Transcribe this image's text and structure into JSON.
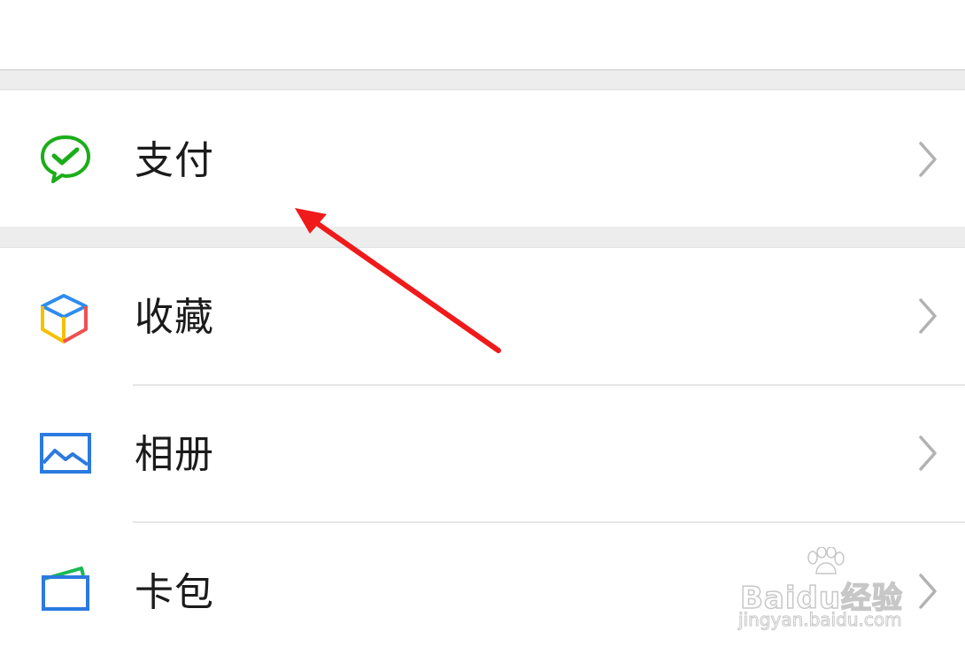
{
  "menu": {
    "items": [
      {
        "label": "支付",
        "icon": "wechat-pay-icon",
        "icon_color": "#1aad19"
      },
      {
        "label": "收藏",
        "icon": "favorites-cube-icon",
        "icon_colors": [
          "#2d8cf0",
          "#f5c000",
          "#f05050"
        ]
      },
      {
        "label": "相册",
        "icon": "album-picture-icon",
        "icon_color": "#2b7ae0"
      },
      {
        "label": "卡包",
        "icon": "card-wallet-icon",
        "icon_colors": [
          "#2b7ae0",
          "#19b955"
        ]
      }
    ],
    "chevron_color": "#b2b2b2"
  },
  "annotation": {
    "color": "#f01a1a",
    "points_to": "支付"
  },
  "watermark": {
    "main": "Baidu经验",
    "sub": "jingyan.baidu.com"
  }
}
